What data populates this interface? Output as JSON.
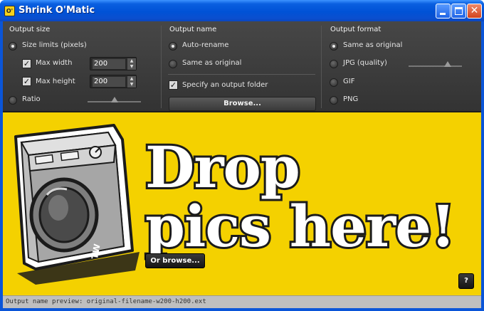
{
  "window": {
    "title": "Shrink O'Matic",
    "icon_text": "O'"
  },
  "output_size": {
    "title": "Output size",
    "size_limits_label": "Size limits (pixels)",
    "max_width_label": "Max width",
    "max_width_value": "200",
    "max_height_label": "Max height",
    "max_height_value": "200",
    "ratio_label": "Ratio",
    "check_glyph": "✓"
  },
  "output_name": {
    "title": "Output name",
    "auto_rename_label": "Auto-rename",
    "same_as_original_label": "Same as original",
    "specify_folder_label": "Specify an output folder",
    "browse_label": "Browse..."
  },
  "output_format": {
    "title": "Output format",
    "same_as_original_label": "Same as original",
    "jpg_label": "JPG (quality)",
    "gif_label": "GIF",
    "png_label": "PNG"
  },
  "drop_area": {
    "line1": "Drop",
    "line2": "pics here!",
    "or_browse_label": "Or browse...",
    "help_label": "?",
    "machine_badge": "TW"
  },
  "status": {
    "text": "Output name preview: original-filename-w200-h200.ext"
  },
  "colors": {
    "drop_background": "#f4d100",
    "panel_background": "#3c3c3c",
    "titlebar": "#0a55d8"
  }
}
